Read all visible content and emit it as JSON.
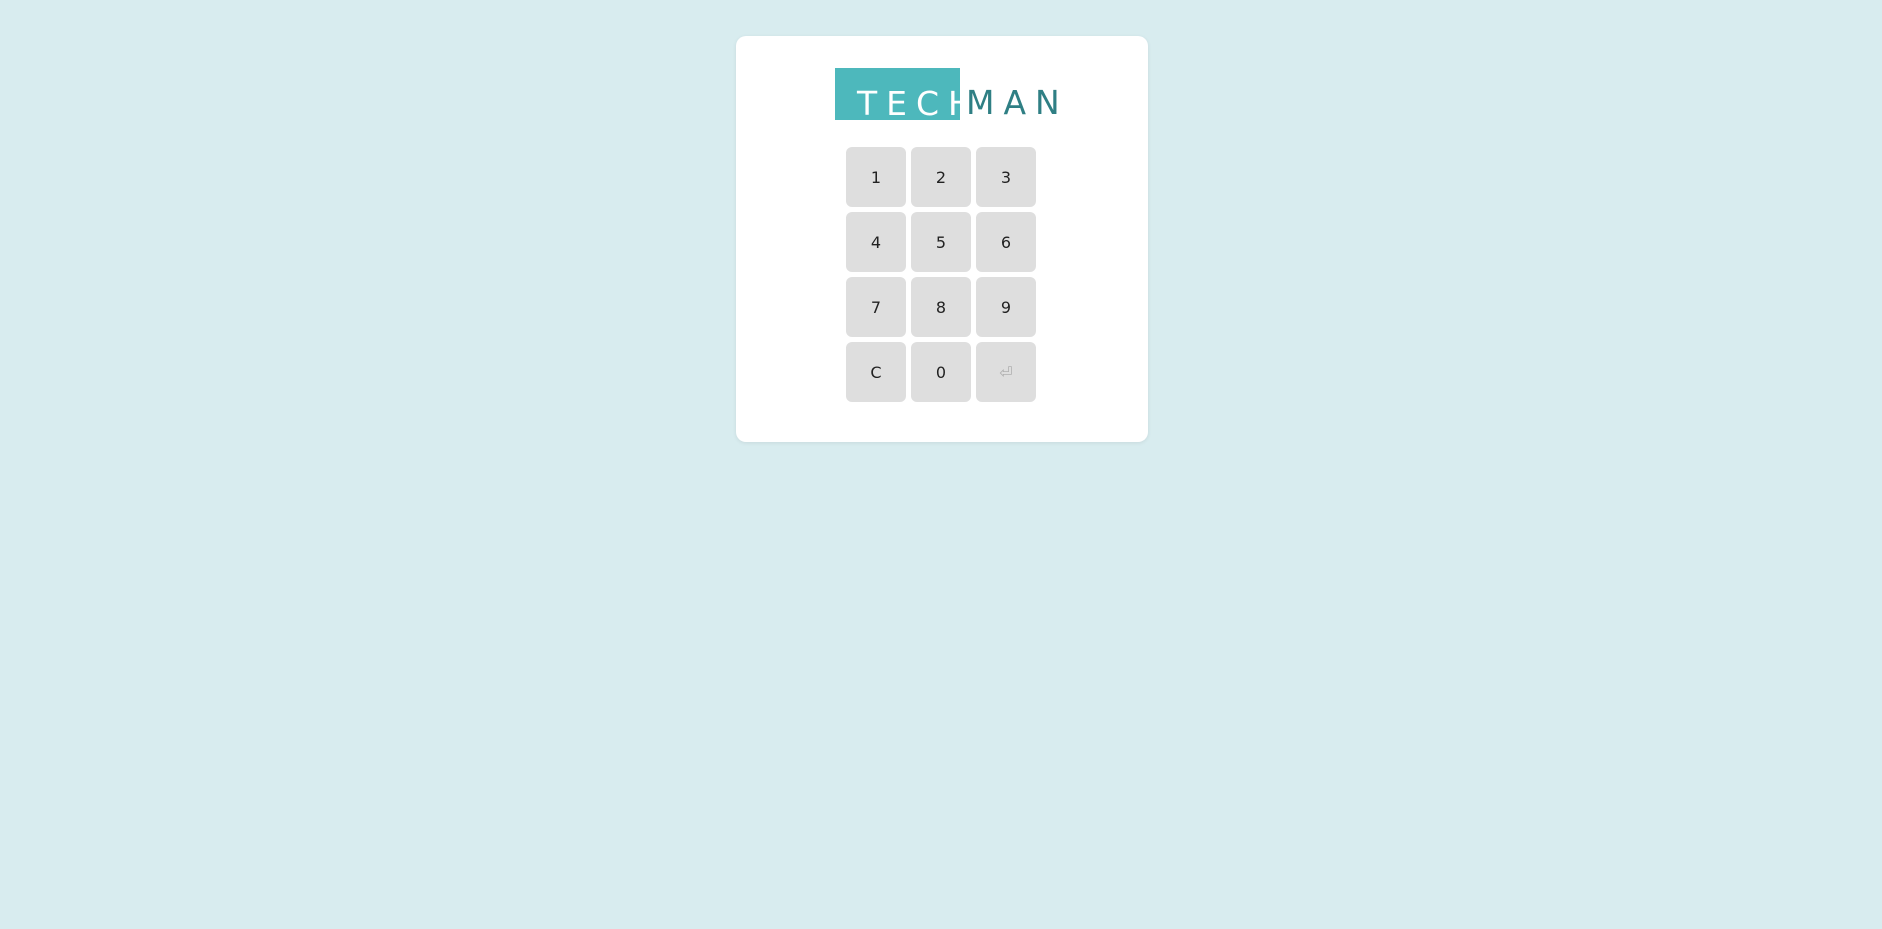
{
  "logo": {
    "part1": "TECH",
    "part2": "MAN"
  },
  "keypad": {
    "keys": [
      "1",
      "2",
      "3",
      "4",
      "5",
      "6",
      "7",
      "8",
      "9",
      "C",
      "0",
      "⏎"
    ],
    "enter_enabled": false
  },
  "colors": {
    "background": "#d8ecef",
    "card": "#ffffff",
    "logo_accent": "#4db8bc",
    "logo_text_dark": "#2f7f84",
    "key_bg": "#dedede"
  }
}
